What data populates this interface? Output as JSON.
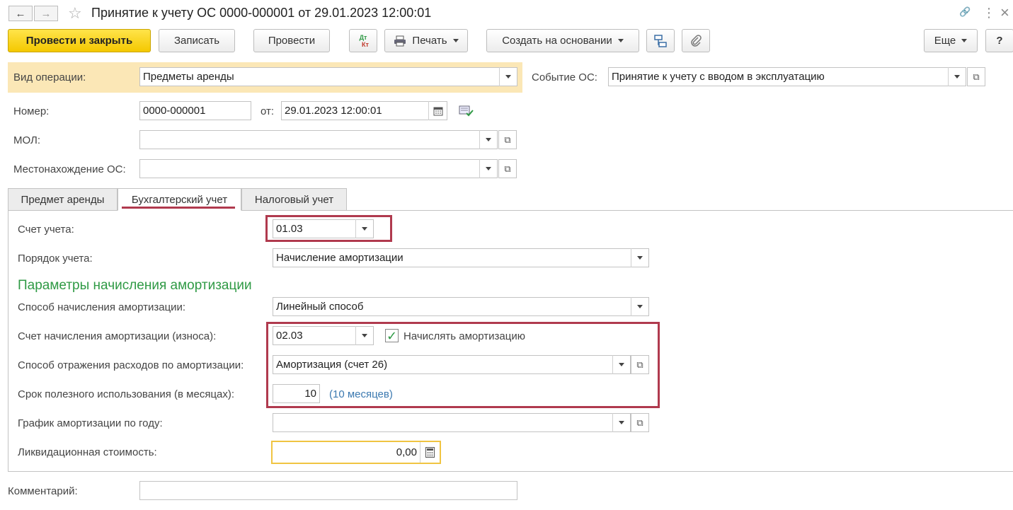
{
  "window": {
    "title": "Принятие к учету ОС 0000-000001 от 29.01.2023 12:00:01",
    "back": "←",
    "forward": "→",
    "star": "☆",
    "link": "🔗",
    "menu": "⋮",
    "close": "×"
  },
  "toolbar": {
    "post_close": "Провести и закрыть",
    "save": "Записать",
    "post": "Провести",
    "dt_top": "Дт",
    "dt_bottom": "Кт",
    "print": "Печать",
    "create_based": "Создать на основании",
    "more": "Еще",
    "help": "?"
  },
  "header": {
    "operation_label": "Вид операции:",
    "operation_value": "Предметы аренды",
    "event_label": "Событие ОС:",
    "event_value": "Принятие к учету с вводом в эксплуатацию",
    "number_label": "Номер:",
    "number_value": "0000-000001",
    "date_label": "от:",
    "date_value": "29.01.2023 12:00:01",
    "mol_label": "МОЛ:",
    "mol_value": "",
    "location_label": "Местонахождение ОС:",
    "location_value": ""
  },
  "tabs": [
    {
      "label": "Предмет аренды"
    },
    {
      "label": "Бухгалтерский учет"
    },
    {
      "label": "Налоговый учет"
    }
  ],
  "accounting": {
    "account_label": "Счет учета:",
    "account_value": "01.03",
    "order_label": "Порядок учета:",
    "order_value": "Начисление амортизации",
    "section_title": "Параметры начисления амортизации",
    "method_label": "Способ начисления амортизации:",
    "method_value": "Линейный способ",
    "depr_account_label": "Счет начисления амортизации (износа):",
    "depr_account_value": "02.03",
    "accrue_label": "Начислять амортизацию",
    "accrue_checked": true,
    "expense_label": "Способ отражения расходов по амортизации:",
    "expense_value": "Амортизация (счет 26)",
    "term_label": "Срок полезного использования (в месяцах):",
    "term_value": "10",
    "term_text": "(10 месяцев)",
    "schedule_label": "График амортизации по году:",
    "schedule_value": "",
    "liquidation_label": "Ликвидационная стоимость:",
    "liquidation_value": "0,00"
  },
  "footer": {
    "comment_label": "Комментарий:",
    "comment_value": ""
  },
  "colors": {
    "highlight": "#b03a4e",
    "section": "#2f9a45",
    "primary": "#f4c800",
    "link": "#3b79b0"
  }
}
